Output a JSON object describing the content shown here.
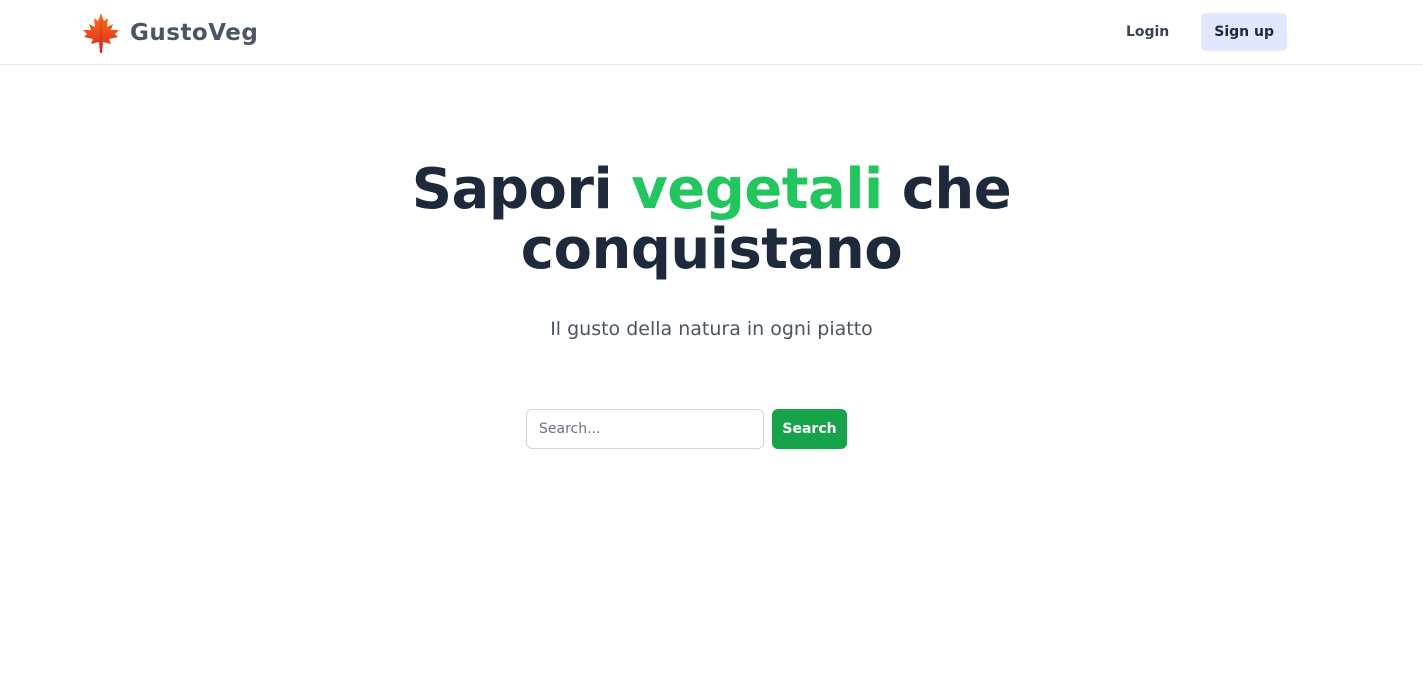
{
  "header": {
    "brand_name": "GustoVeg",
    "logo_icon": "maple-leaf-icon",
    "login_label": "Login",
    "signup_label": "Sign up"
  },
  "hero": {
    "title_part1": "Sapori",
    "title_accent": "vegetali",
    "title_part2": "che",
    "title_line2": "conquistano",
    "subtitle": "Il gusto della natura in ogni piatto"
  },
  "search": {
    "placeholder": "Search...",
    "value": "",
    "button_label": "Search"
  },
  "colors": {
    "accent": "#22c55e",
    "primary_button": "#16a34a",
    "signup_bg": "#e0e7ff",
    "heading": "#1e293b"
  }
}
